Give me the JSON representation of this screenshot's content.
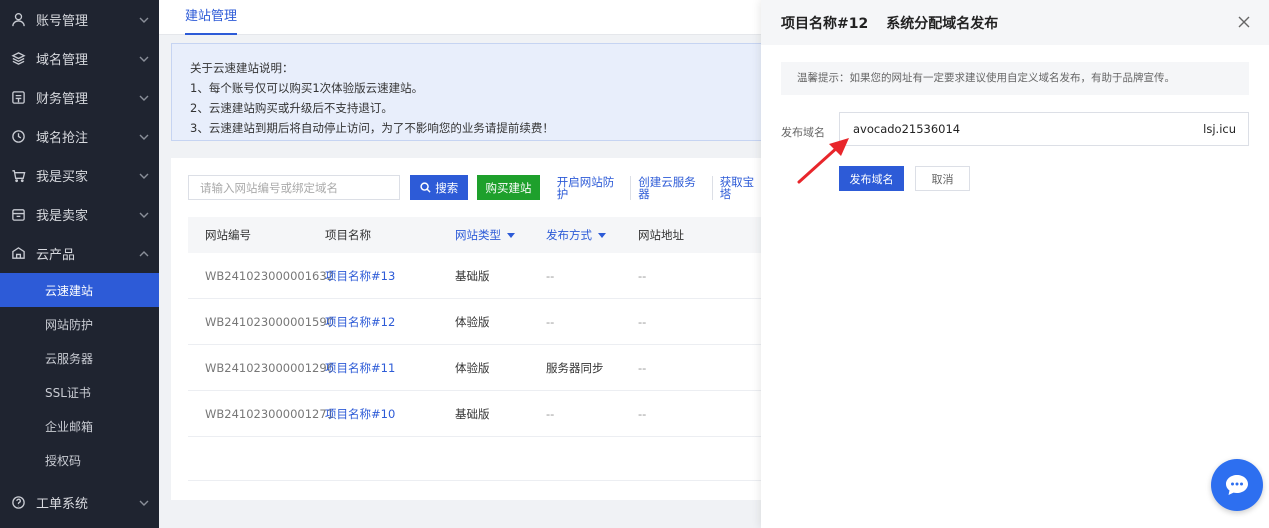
{
  "sidebar": {
    "items": [
      {
        "label": "账号管理",
        "icon": "user-icon"
      },
      {
        "label": "域名管理",
        "icon": "layers-icon"
      },
      {
        "label": "财务管理",
        "icon": "wallet-icon"
      },
      {
        "label": "域名抢注",
        "icon": "clock-icon"
      },
      {
        "label": "我是买家",
        "icon": "cart-icon"
      },
      {
        "label": "我是卖家",
        "icon": "store-icon"
      },
      {
        "label": "云产品",
        "icon": "cloud-icon"
      }
    ],
    "sub_items": [
      "云速建站",
      "网站防护",
      "云服务器",
      "SSL证书",
      "企业邮箱",
      "授权码"
    ],
    "bottom_item": {
      "label": "工单系统",
      "icon": "help-icon"
    }
  },
  "main": {
    "tab": "建站管理",
    "notice": [
      "关于云速建站说明：",
      "1、每个账号仅可以购买1次体验版云速建站。",
      "2、云速建站购买或升级后不支持退订。",
      "3、云速建站到期后将自动停止访问，为了不影响您的业务请提前续费！"
    ],
    "search_placeholder": "请输入网站编号或绑定域名",
    "search_button": "搜索",
    "buy_button": "购买建站",
    "links": [
      "开启网站防护",
      "创建云服务器",
      "获取宝塔"
    ],
    "columns": [
      "网站编号",
      "项目名称",
      "网站类型",
      "发布方式",
      "网站地址"
    ],
    "rows": [
      [
        "WB241023000001632",
        "项目名称#13",
        "基础版",
        "--",
        "--"
      ],
      [
        "WB241023000001590",
        "项目名称#12",
        "体验版",
        "--",
        "--"
      ],
      [
        "WB241023000001296",
        "项目名称#11",
        "体验版",
        "服务器同步",
        "--"
      ],
      [
        "WB241023000001271",
        "项目名称#10",
        "基础版",
        "--",
        "--"
      ]
    ]
  },
  "drawer": {
    "title_project": "项目名称#12",
    "title_action": "系统分配域名发布",
    "tip": "温馨提示：如果您的网址有一定要求建议使用自定义域名发布，有助于品牌宣传。",
    "field_label": "发布域名",
    "field_value": "avocado21536014",
    "field_suffix": "lsj.icu",
    "publish_button": "发布域名",
    "cancel_button": "取消"
  },
  "colors": {
    "accent": "#2d5bd7",
    "buy": "#1ea02c",
    "sidebar": "#1f2430",
    "arrow": "#e8262b"
  }
}
